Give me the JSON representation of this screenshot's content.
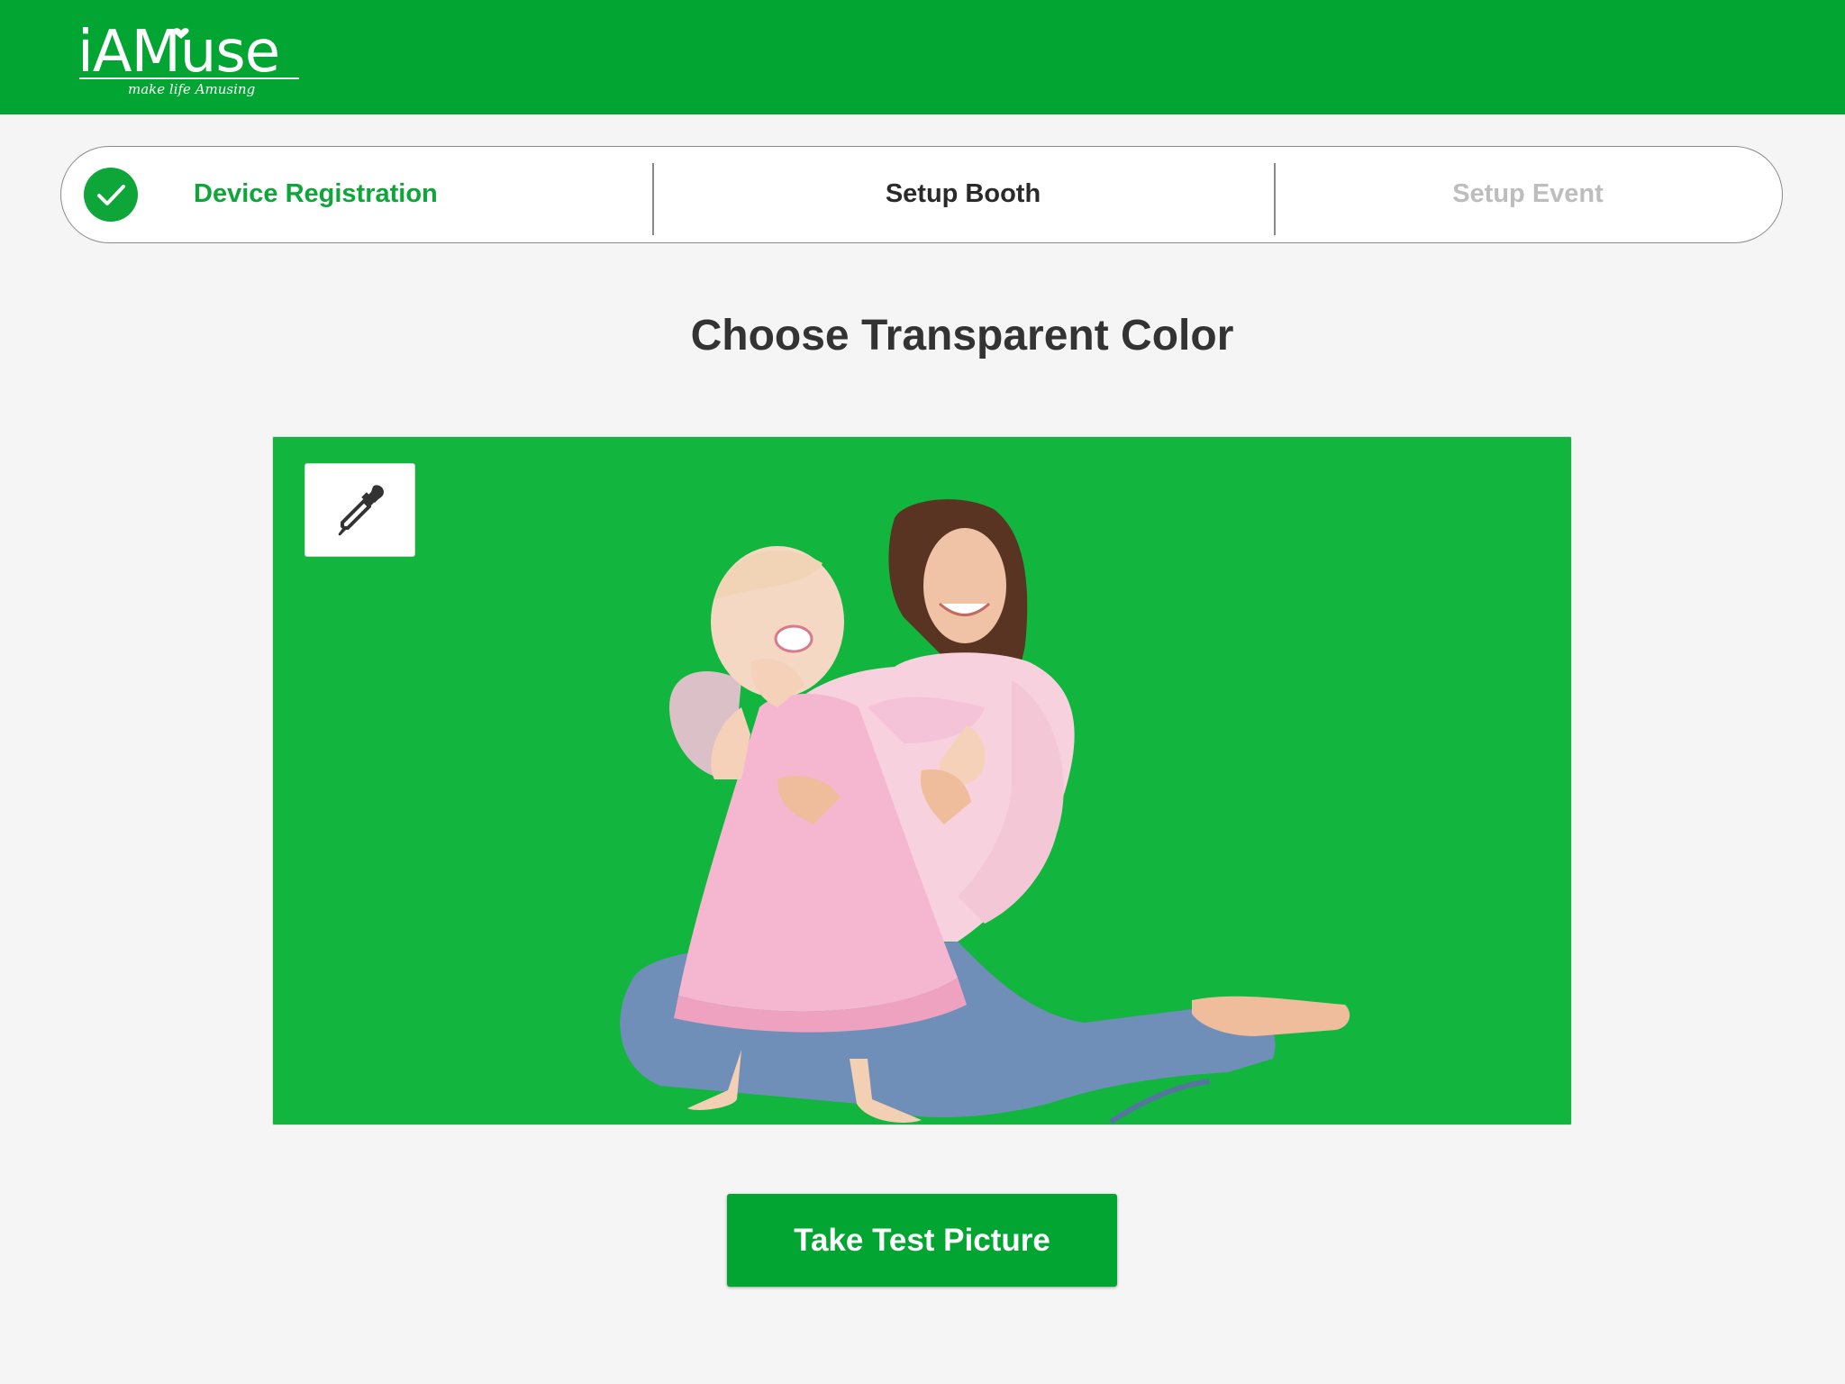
{
  "header": {
    "logo_text": "iAMuse",
    "logo_tagline": "make life Amusing",
    "background": "#03a532"
  },
  "stepper": {
    "steps": [
      {
        "label": "Device Registration",
        "state": "completed",
        "color": "#0ea539",
        "icon": "check-icon"
      },
      {
        "label": "Setup Booth",
        "state": "current",
        "color": "#2a2a2a"
      },
      {
        "label": "Setup Event",
        "state": "upcoming",
        "color": "#bdbdbd"
      }
    ]
  },
  "main": {
    "title": "Choose Transparent Color",
    "preview": {
      "background_color": "#12b53d",
      "tool_icon": "eyedropper-icon",
      "photo_subject": "mother-and-baby-photo"
    },
    "action_button_label": "Take Test Picture",
    "action_button_color": "#03a532"
  }
}
